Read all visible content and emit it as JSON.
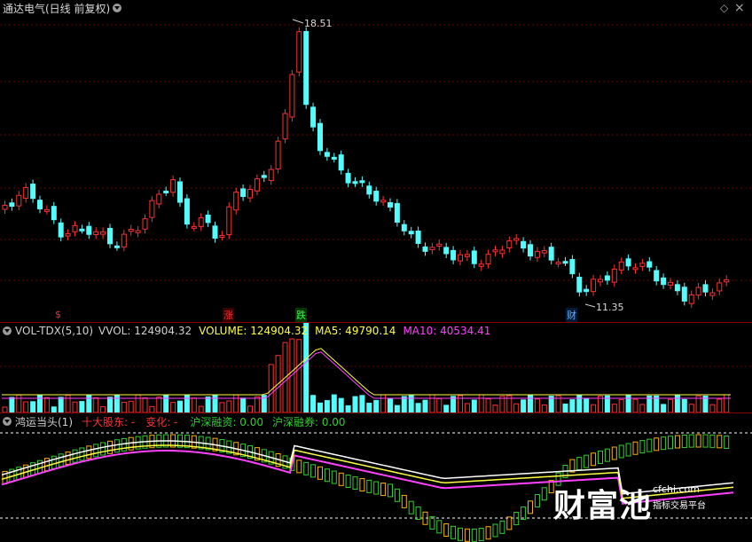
{
  "title": "通达电气(日线 前复权)",
  "top_icons": {
    "diamond": "◇",
    "close": "×"
  },
  "price_pane": {
    "high_label": "18.51",
    "low_label": "11.35",
    "event_tags": [
      {
        "text": "$",
        "color": "#ff3030"
      },
      {
        "text": "涨",
        "color": "#ff3030"
      },
      {
        "text": "跌",
        "color": "#30ff30"
      },
      {
        "text": "财",
        "color": "#60b0ff"
      }
    ]
  },
  "vol_pane": {
    "name": "VOL-TDX(5,10)",
    "items": [
      {
        "label": "VVOL: 124904.32",
        "color": "#d0d0d0"
      },
      {
        "label": "VOLUME: 124904.32",
        "color": "#ffff40"
      },
      {
        "label": "MA5: 49790.14",
        "color": "#ffff40"
      },
      {
        "label": "MA10: 40534.41",
        "color": "#ff40ff"
      }
    ]
  },
  "ind_pane": {
    "name": "鸿运当头(1)",
    "items": [
      {
        "label": "十大股东: -",
        "color": "#ff3030"
      },
      {
        "label": "变化: -",
        "color": "#ff3030"
      },
      {
        "label": "沪深融资: 0.00",
        "color": "#30d030"
      },
      {
        "label": "沪深融券: 0.00",
        "color": "#30d030"
      }
    ]
  },
  "watermark": {
    "brand": "财富池",
    "url": "cfchi.com",
    "slogan": "指标交易平台"
  },
  "colors": {
    "up": "#ff3030",
    "down": "#54fcfc",
    "frame": "#8b0000",
    "ma5": "#ffff40",
    "ma10": "#ff40ff"
  }
}
